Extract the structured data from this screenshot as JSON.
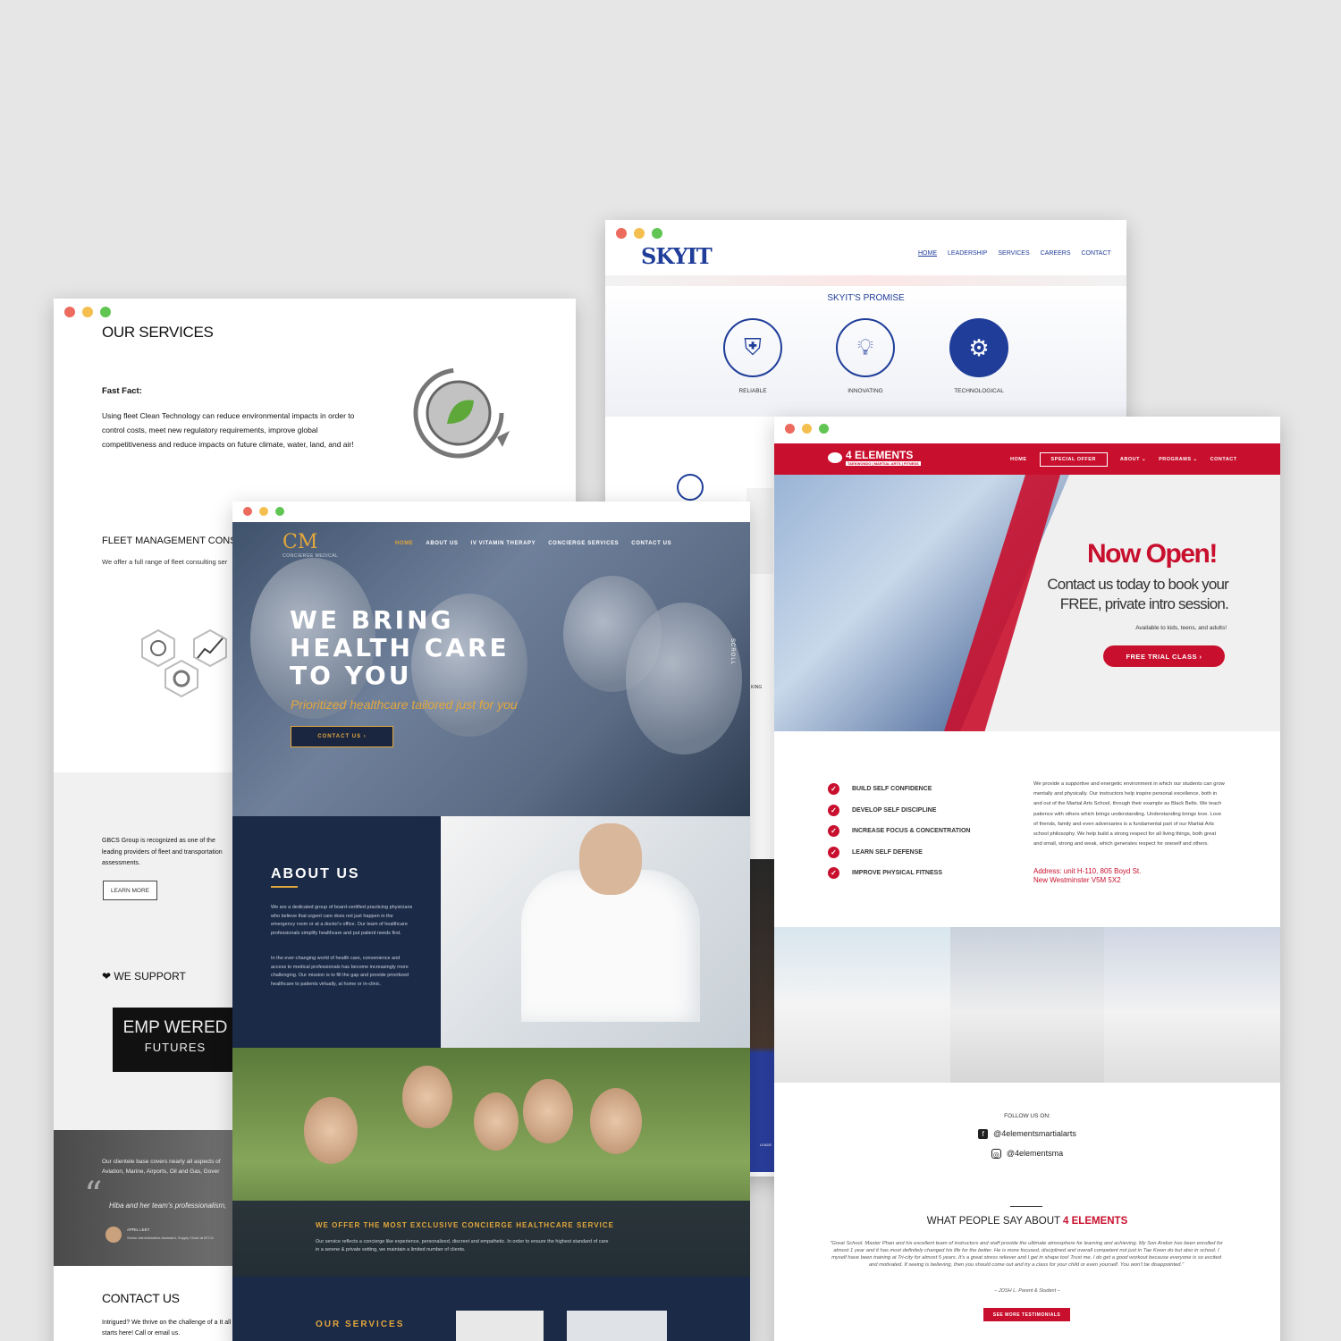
{
  "gbcs": {
    "services_title": "OUR SERVICES",
    "fast_fact_label": "Fast Fact:",
    "fast_fact_text": "Using fleet Clean Technology can reduce environmental impacts in order to control costs, meet new regulatory requirements, improve global competitiveness and reduce impacts on future climate, water, land, and air!",
    "fleet_title": "FLEET MANAGEMENT CONS",
    "fleet_text": "We offer a full range of fleet consulting ser",
    "about_text": "GBCS Group is recognized as one of the leading providers of fleet and transportation assessments.",
    "learn_more": "LEARN MORE",
    "support_title": "WE SUPPORT",
    "empowered_line1": "EMP WERED",
    "empowered_line2": "FUTURES",
    "clientele_text": "Our clientele base covers nearly all aspects of Aviation, Marine, Airports, Oil and Gas, Gover",
    "testimonial_text": "Hiba and her team's professionalism,",
    "testimonial_name": "APRIL LEET",
    "testimonial_role": "Senior Administrative Assistant, Supply Chain at ATCO",
    "contact_title": "CONTACT US",
    "contact_text": "Intrigued? We thrive on the challenge of a It all starts here! Call or email us."
  },
  "skyit": {
    "logo": "SKYIT",
    "nav": [
      "HOME",
      "LEADERSHIP",
      "SERVICES",
      "CAREERS",
      "CONTACT"
    ],
    "promise_title": "SKYIT'S PROMISE",
    "items": [
      "RELIABLE",
      "INNOVATING",
      "TECHNOLOGICAL"
    ],
    "partial_text": "KING",
    "partial_button": "LEADE"
  },
  "cm": {
    "logo_mark": "CM",
    "logo_sub": "CONCIERGE MEDICAL",
    "nav": [
      "HOME",
      "ABOUT US",
      "IV VITAMIN THERAPY",
      "CONCIERGE SERVICES",
      "CONTACT US"
    ],
    "hero_title": "WE BRING HEALTH CARE TO YOU",
    "hero_sub": "Prioritized healthcare tailored just for you",
    "cta": "CONTACT US ›",
    "scroll": "SCROLL",
    "about_title": "ABOUT US",
    "about_p1": "We are a dedicated group of board-certified practicing physicians who believe that urgent care does not just happen in the emergency room or at a doctor's office. Our team of healthcare professionals simplify healthcare and put patient needs first.",
    "about_p2": "In the ever-changing world of health care, convenience and access to medical professionals has become increasingly more challenging. Our mission is to fill the gap and provide prioritized healthcare to patients virtually, at home or in-clinic.",
    "offer_title": "WE OFFER THE MOST EXCLUSIVE CONCIERGE HEALTHCARE SERVICE",
    "offer_text": "Our service reflects a concierge like experience, personalized, discreet and empathetic. In order to ensure the highest standard of care in a serene & private setting, we maintain a limited number of clients.",
    "services_title": "OUR SERVICES"
  },
  "fe": {
    "logo": "4 ELEMENTS",
    "logo_sub": "TAEKWONDO | MARTIAL ARTS | FITNESS",
    "nav": [
      "HOME",
      "SPECIAL OFFER",
      "ABOUT ⌄",
      "PROGRAMS ⌄",
      "CONTACT"
    ],
    "hero_title": "Now Open!",
    "hero_sub": "Contact us today to book your FREE, private intro session.",
    "hero_small": "Available to kids, teens, and adults!",
    "trial_btn": "FREE TRIAL CLASS ›",
    "benefits": [
      "BUILD SELF CONFIDENCE",
      "DEVELOP SELF DISCIPLINE",
      "INCREASE FOCUS & CONCENTRATION",
      "LEARN SELF DEFENSE",
      "IMPROVE PHYSICAL FITNESS"
    ],
    "about_text": "We provide a supportive and energetic environment in which our students can grow mentally and physically. Our instructors help inspire personal excellence, both in and out of the Martial Arts School, through their example as Black Belts. We teach patience with others which brings understanding. Understanding brings love. Love of friends, family and even adversaries is a fundamental part of our Martial Arts school philosophy. We help build a strong respect for all living things, both great and small, strong and weak, which generates respect for oneself and others.",
    "address_line1": "Address: unit H-110, 805 Boyd St.",
    "address_line2": "New Westminster V5M 5X2",
    "follow": "FOLLOW US ON:",
    "facebook": "@4elementsmartialarts",
    "instagram": "@4elementsma",
    "what_people": "WHAT PEOPLE SAY ABOUT",
    "what_brand": "4 ELEMENTS",
    "quote": "\"Great School. Master Phan and his excellent team of instructors and staff provide the ultimate atmosphere for learning and achieving. My Son Andon has been enrolled for almost 1 year and it has most definitely changed his life for the better. He is more focused, disciplined and overall competent not just in Tae Kwon do but also in school. I myself have been training at Tri-city for almost 5 years. It's a great stress reliever and I get in shape too! Trust me, I do get a good workout because everyone is so excited and motivated. If seeing is believing, then you should come out and try a class for your child or even yourself. You won't be disappointed.\"",
    "author": "– JOSH L. Parent & Student –",
    "more_btn": "SEE MORE TESTIMONIALS"
  }
}
